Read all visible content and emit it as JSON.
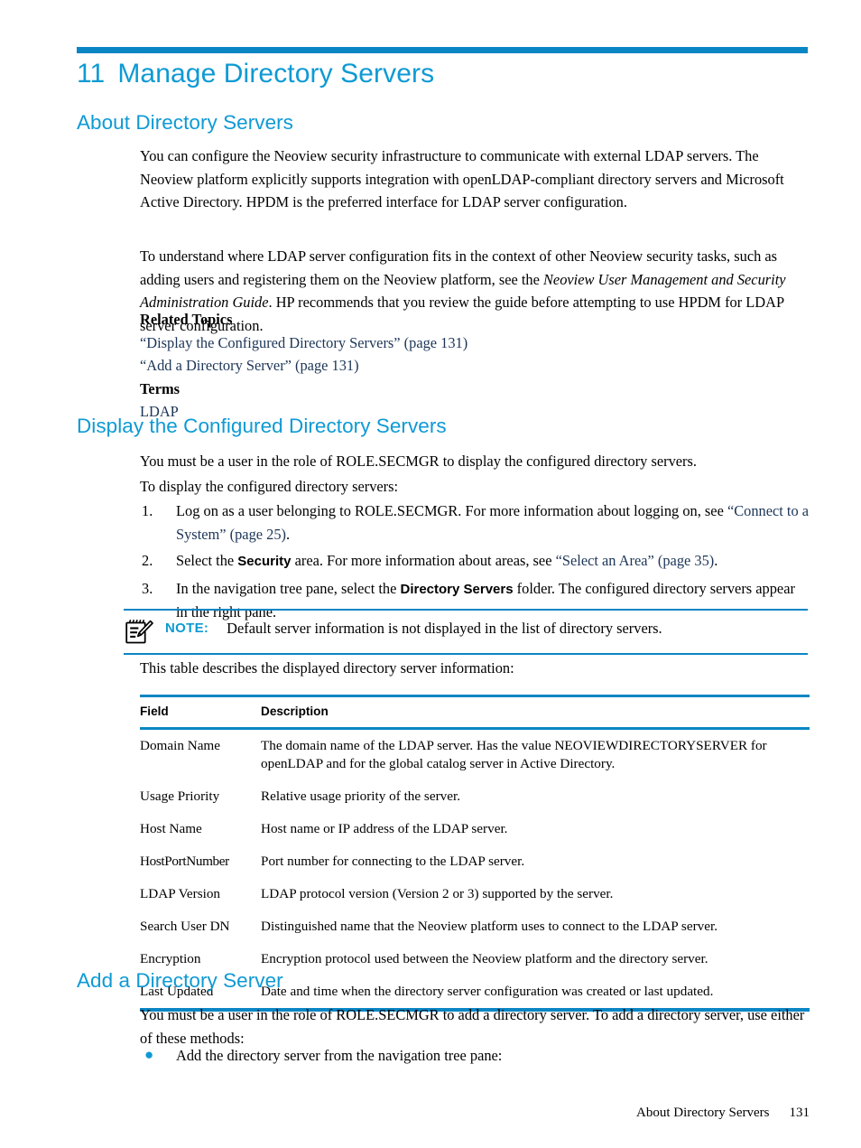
{
  "document": {
    "chapter_number": "11",
    "chapter_title": "Manage Directory Servers"
  },
  "sections": {
    "about": {
      "heading": "About Directory Servers",
      "para1": "You can configure the Neoview security infrastructure to communicate with external LDAP servers. The Neoview platform explicitly supports integration with openLDAP-compliant directory servers and Microsoft Active Directory. HPDM is the preferred interface for LDAP server configuration.",
      "para2_a": "To understand where LDAP server configuration fits in the context of other Neoview security tasks, such as adding users and registering them on the Neoview platform, see the ",
      "para2_italic": "Neoview User Management and Security Administration Guide",
      "para2_b": ". HP recommends that you review the guide before attempting to use HPDM for LDAP server configuration.",
      "related_topics_heading": "Related Topics",
      "related_links": [
        "“Display the Configured Directory Servers” (page 131)",
        "“Add a Directory Server” (page 131)"
      ],
      "terms_heading": "Terms",
      "terms": [
        "LDAP"
      ]
    },
    "display": {
      "heading": "Display the Configured Directory Servers",
      "para1": "You must be a user in the role of ROLE.SECMGR to display the configured directory servers.",
      "para2": "To display the configured directory servers:",
      "steps": [
        {
          "marker": "1.",
          "text_a": "Log on as a user belonging to ROLE.SECMGR. For more information about logging on, see ",
          "xref": "“Connect to a System” (page 25)",
          "text_b": "."
        },
        {
          "marker": "2.",
          "text_a": "Select the ",
          "ui_term": "Security",
          "text_b": " area. For more information about areas, see ",
          "xref": "“Select an Area” (page 35)",
          "text_c": "."
        },
        {
          "marker": "3.",
          "text_a": "In the navigation tree pane, select the ",
          "ui_term": "Directory Servers",
          "text_b": " folder. The configured directory servers appear in the right pane.",
          "xref": "",
          "text_c": ""
        }
      ],
      "note": {
        "icon": "note-pad-pencil-icon",
        "label": "NOTE:",
        "text": "Default server information is not displayed in the list of directory servers."
      },
      "table_intro": "This table describes the displayed directory server information:",
      "table": {
        "columns": [
          "Field",
          "Description"
        ],
        "rows": [
          {
            "field": "Domain Name",
            "description": "The domain name of the LDAP server. Has the value NEOVIEWDIRECTORYSERVER for openLDAP and for the global catalog server in Active Directory."
          },
          {
            "field": "Usage Priority",
            "description": "Relative usage priority of the server."
          },
          {
            "field": "Host Name",
            "description": "Host name or IP address of the LDAP server."
          },
          {
            "field": "HostPortNumber",
            "description": "Port number for connecting to the LDAP server."
          },
          {
            "field": "LDAP Version",
            "description": "LDAP protocol version (Version 2 or 3) supported by the server."
          },
          {
            "field": "Search User DN",
            "description": "Distinguished name that the Neoview platform uses to connect to the LDAP server."
          },
          {
            "field": "Encryption",
            "description": "Encryption protocol used between the Neoview platform and the directory server."
          },
          {
            "field": "Last Updated",
            "description": "Date and time when the directory server configuration was created or last updated."
          }
        ]
      }
    },
    "add": {
      "heading": "Add a Directory Server",
      "para1": "You must be a user in the role of ROLE.SECMGR to add a directory server. To add a directory server, use either of these methods:",
      "bullets": [
        "Add the directory server from the navigation tree pane:"
      ]
    }
  },
  "footer": {
    "section_name": "About Directory Servers",
    "page_number": "131"
  },
  "colors": {
    "heading_blue": "#0e9ad4",
    "rule_blue": "#0b86c4",
    "xref_navy": "#1c3557"
  }
}
